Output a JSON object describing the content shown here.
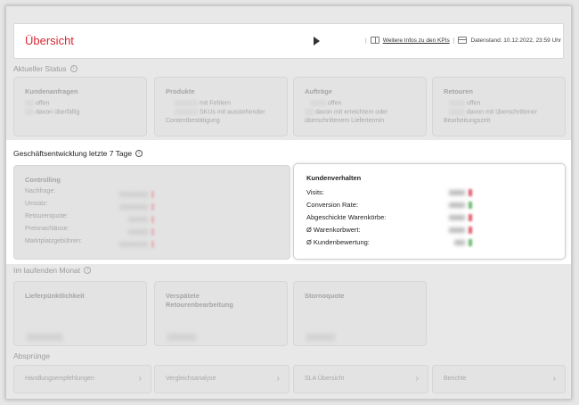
{
  "header": {
    "title": "Übersicht",
    "link_label": "Weitere Infos zu den KPIs",
    "date_label": "Datenstand: 10.12.2022, 23:59 Uhr"
  },
  "status": {
    "title": "Aktueller Status",
    "cards": [
      {
        "title": "Kundenanfragen",
        "line1": "offen",
        "line2": "davon überfällig"
      },
      {
        "title": "Produkte",
        "line1": "mit Fehlern",
        "line2": "SKUs mit ausstehender",
        "line3": "Contentbestätigung"
      },
      {
        "title": "Aufträge",
        "line1": "offen",
        "line2": "davon mit erreichtem oder",
        "line3": "überschrittenem Liefertermin"
      },
      {
        "title": "Retouren",
        "line1": "offen",
        "line2": "davon mit überschrittener",
        "line3": "Bearbeitungszeit"
      }
    ]
  },
  "business": {
    "title": "Geschäftsentwicklung letzte 7 Tage",
    "controlling": {
      "title": "Controlling",
      "rows": [
        "Nachfrage:",
        "Umsatz:",
        "Retourenquote:",
        "Preisnachlässe:",
        "Marktplatzgebühren:"
      ]
    },
    "customer": {
      "title": "Kundenverhalten",
      "rows": [
        "Visits:",
        "Conversion Rate:",
        "Abgeschickte Warenkörbe:",
        "Ø Warenkorbwert:",
        "Ø Kundenbewertung:"
      ]
    }
  },
  "month": {
    "title": "Im laufenden Monat",
    "cards": [
      {
        "title": "Lieferpünktlichkeit"
      },
      {
        "title": "Verspätete",
        "title2": "Retourenbearbeitung"
      },
      {
        "title": "Stornoquote"
      }
    ]
  },
  "jumps": {
    "title": "Absprünge",
    "items": [
      "Handlungsempfehlungen",
      "Vergleichsanalyse",
      "SLA Übersicht",
      "Berichte"
    ]
  },
  "colors": {
    "accent": "#d42a33",
    "trend_down": "#e05a6a",
    "trend_up": "#6ab86e"
  }
}
